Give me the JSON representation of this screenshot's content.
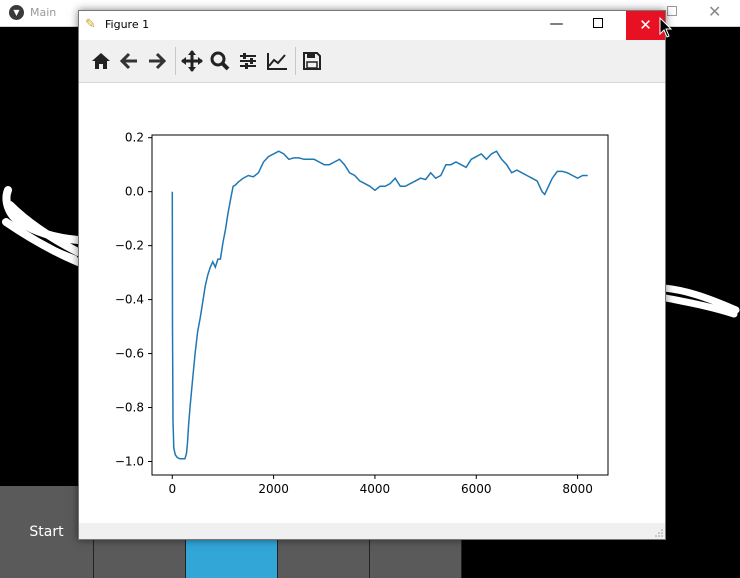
{
  "main_window": {
    "title": "Main",
    "start_label": "Start"
  },
  "figure_window": {
    "title": "Figure 1",
    "close_glyph": "✕",
    "minimize_glyph": "—",
    "toolbar": [
      "home-icon",
      "back-icon",
      "forward-icon",
      "pan-icon",
      "zoom-icon",
      "configure-subplots-icon",
      "edit-axis-icon",
      "save-icon"
    ]
  },
  "colors": {
    "accent_button": "#33a6d8",
    "close_red": "#e81123",
    "line": "#1f77b4"
  },
  "chart_data": {
    "type": "line",
    "title": "",
    "xlabel": "",
    "ylabel": "",
    "xlim": [
      -400,
      8600
    ],
    "ylim": [
      -1.05,
      0.21
    ],
    "xticks": [
      0,
      2000,
      4000,
      6000,
      8000
    ],
    "xtick_labels": [
      "0",
      "2000",
      "4000",
      "6000",
      "8000"
    ],
    "yticks": [
      0.2,
      0.0,
      -0.2,
      -0.4,
      -0.6,
      -0.8,
      -1.0
    ],
    "ytick_labels": [
      "0.2",
      "0.0",
      "−0.2",
      "−0.4",
      "−0.6",
      "−0.8",
      "−1.0"
    ],
    "grid": false,
    "series": [
      {
        "x": [
          0,
          5,
          15,
          30,
          60,
          100,
          150,
          200,
          250,
          280,
          300,
          320,
          350,
          400,
          450,
          500,
          550,
          600,
          650,
          700,
          750,
          800,
          850,
          900,
          950,
          1000,
          1050,
          1100,
          1150,
          1200,
          1250,
          1300,
          1400,
          1500,
          1600,
          1700,
          1800,
          1900,
          2000,
          2100,
          2200,
          2300,
          2400,
          2500,
          2600,
          2700,
          2800,
          2900,
          3000,
          3100,
          3200,
          3300,
          3400,
          3500,
          3600,
          3700,
          3800,
          3900,
          4000,
          4100,
          4200,
          4300,
          4400,
          4500,
          4600,
          4700,
          4800,
          4900,
          5000,
          5100,
          5200,
          5300,
          5400,
          5500,
          5600,
          5700,
          5800,
          5900,
          6000,
          6100,
          6200,
          6300,
          6400,
          6500,
          6600,
          6700,
          6800,
          6900,
          7000,
          7100,
          7200,
          7300,
          7350,
          7400,
          7500,
          7600,
          7700,
          7800,
          7900,
          8000,
          8100,
          8200
        ],
        "y": [
          0.0,
          -0.5,
          -0.85,
          -0.95,
          -0.975,
          -0.985,
          -0.99,
          -0.99,
          -0.99,
          -0.97,
          -0.93,
          -0.87,
          -0.8,
          -0.7,
          -0.6,
          -0.52,
          -0.47,
          -0.41,
          -0.35,
          -0.31,
          -0.28,
          -0.26,
          -0.28,
          -0.25,
          -0.25,
          -0.19,
          -0.14,
          -0.08,
          -0.03,
          0.02,
          0.025,
          0.035,
          0.05,
          0.06,
          0.055,
          0.07,
          0.11,
          0.13,
          0.14,
          0.15,
          0.14,
          0.12,
          0.125,
          0.125,
          0.12,
          0.12,
          0.12,
          0.11,
          0.1,
          0.1,
          0.11,
          0.12,
          0.1,
          0.07,
          0.06,
          0.04,
          0.03,
          0.02,
          0.005,
          0.02,
          0.02,
          0.03,
          0.05,
          0.02,
          0.02,
          0.03,
          0.04,
          0.05,
          0.045,
          0.07,
          0.05,
          0.06,
          0.1,
          0.1,
          0.11,
          0.1,
          0.09,
          0.12,
          0.13,
          0.14,
          0.12,
          0.14,
          0.15,
          0.12,
          0.1,
          0.07,
          0.08,
          0.07,
          0.06,
          0.05,
          0.04,
          0.0,
          -0.01,
          0.01,
          0.05,
          0.075,
          0.075,
          0.07,
          0.06,
          0.05,
          0.06,
          0.06
        ]
      }
    ]
  }
}
